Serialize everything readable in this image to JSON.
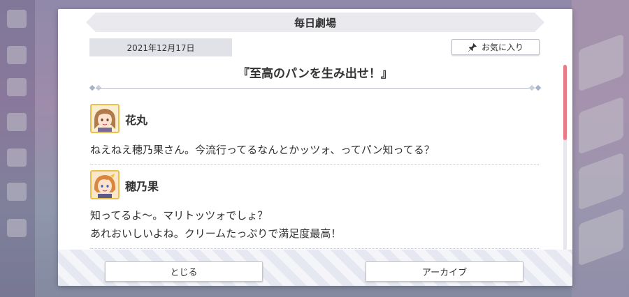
{
  "dialog": {
    "title": "毎日劇場",
    "date": "2021年12月17日",
    "favorite_label": "お気に入り",
    "story_title": "『至高のパンを生み出せ！』"
  },
  "dialogue": [
    {
      "speaker": "花丸",
      "lines": [
        "ねえねえ穂乃果さん。今流行ってるなんとかッツォ、ってパン知ってる？"
      ]
    },
    {
      "speaker": "穂乃果",
      "lines": [
        "知ってるよ～。マリトッツォでしょ？",
        "あれおいしいよね。クリームたっぷりで満足度最高！"
      ]
    }
  ],
  "footer": {
    "close_label": "とじる",
    "archive_label": "アーカイブ"
  },
  "scrollbar": {
    "position": 0.0
  },
  "colors": {
    "accent_scroll": "#e97b86",
    "avatar_border": "#e8c04a",
    "title_bar": "#e9e9ee",
    "date_box": "#e1e1e8"
  },
  "icons": {
    "favorite": "pin-icon",
    "avatar_1": "character-avatar-hanamaru",
    "avatar_2": "character-avatar-honoka"
  }
}
